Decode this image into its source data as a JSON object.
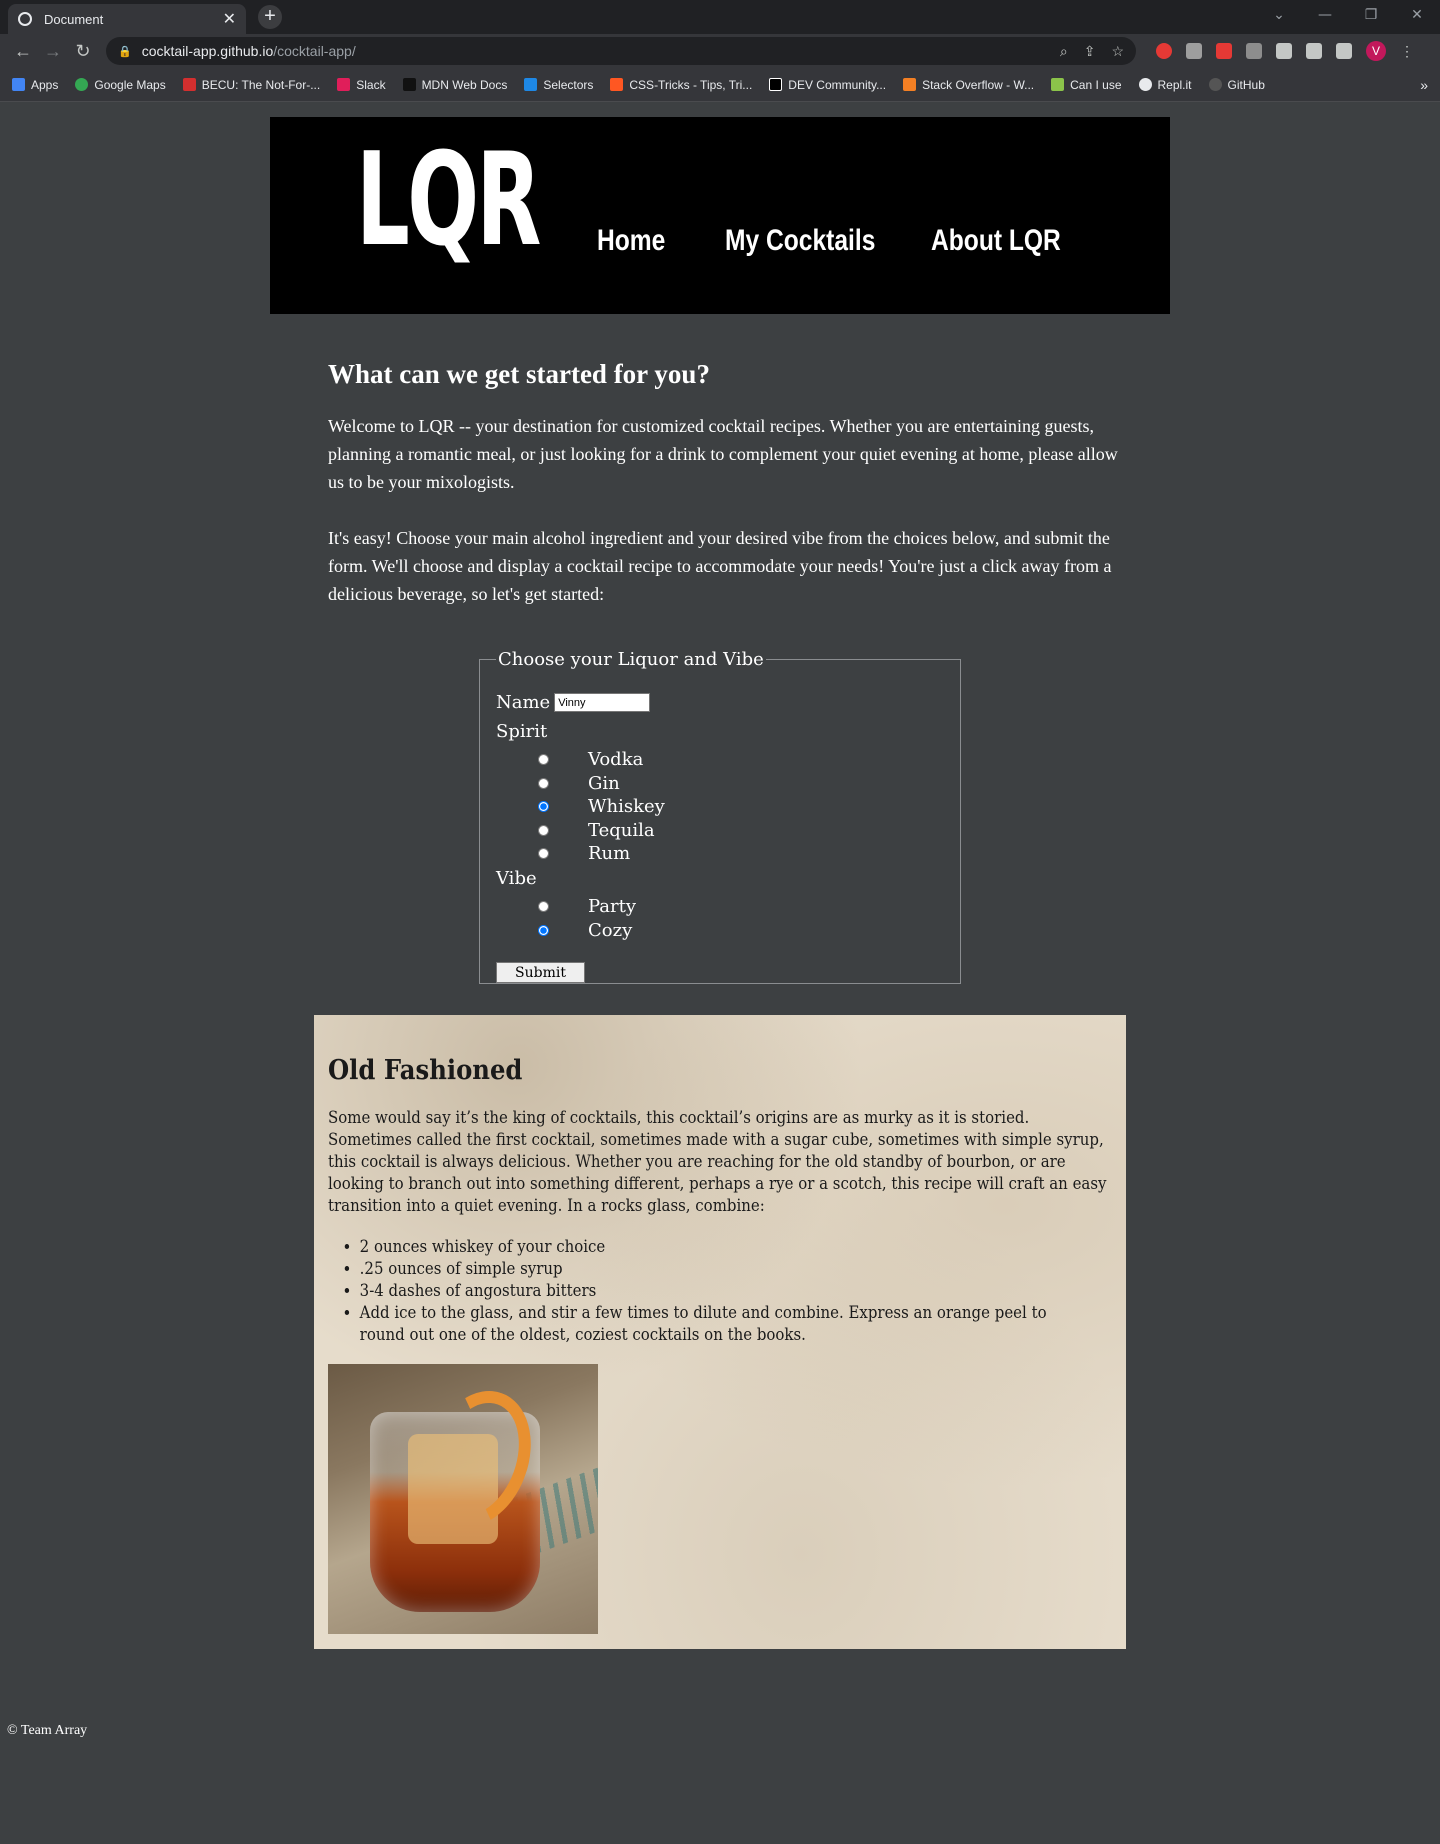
{
  "browser": {
    "tab_title": "Document",
    "new_tab": "+",
    "url_host": "cocktail-app.github.io",
    "url_path": "/cocktail-app/",
    "profile_initial": "V",
    "bookmarks": [
      "Apps",
      "Google Maps",
      "BECU: The Not-For-...",
      "Slack",
      "MDN Web Docs",
      "Selectors",
      "CSS-Tricks - Tips, Tri...",
      "DEV Community...",
      "Stack Overflow - W...",
      "Can I use",
      "Repl.it",
      "GitHub"
    ],
    "bookmarks_more": "»"
  },
  "header": {
    "logo": "LQR",
    "nav": [
      "Home",
      "My Cocktails",
      "About LQR"
    ]
  },
  "intro": {
    "heading": "What can we get started for you?",
    "para1": "Welcome to LQR -- your destination for customized cocktail recipes. Whether you are entertaining guests, planning a romantic meal, or just looking for a drink to complement your quiet evening at home, please allow us to be your mixologists.",
    "para2": "It's easy! Choose your main alcohol ingredient and your desired vibe from the choices below, and submit the form. We'll choose and display a cocktail recipe to accommodate your needs! You're just a click away from a delicious beverage, so let's get started:"
  },
  "form": {
    "legend": "Choose your Liquor and Vibe",
    "name_label": "Name",
    "name_value": "Vinny",
    "spirit_label": "Spirit",
    "spirits": [
      "Vodka",
      "Gin",
      "Whiskey",
      "Tequila",
      "Rum"
    ],
    "spirit_selected": "Whiskey",
    "vibe_label": "Vibe",
    "vibes": [
      "Party",
      "Cozy"
    ],
    "vibe_selected": "Cozy",
    "submit_label": "Submit"
  },
  "recipe": {
    "title": "Old Fashioned",
    "description": "Some would say it’s the king of cocktails, this cocktail’s origins are as murky as it is storied. Sometimes called the first cocktail, sometimes made with a sugar cube, sometimes with simple syrup, this cocktail is always delicious. Whether you are reaching for the old standby of bourbon, or are looking to branch out into something different, perhaps a rye or a scotch, this recipe will craft an easy transition into a quiet evening. In a rocks glass, combine:",
    "ingredients": [
      "2 ounces whiskey of your choice",
      ".25 ounces of simple syrup",
      "3-4 dashes of angostura bitters",
      "Add ice to the glass, and stir a few times to dilute and combine. Express an orange peel to round out one of the oldest, coziest cocktails on the books."
    ]
  },
  "footer": {
    "text": "© Team Array"
  }
}
